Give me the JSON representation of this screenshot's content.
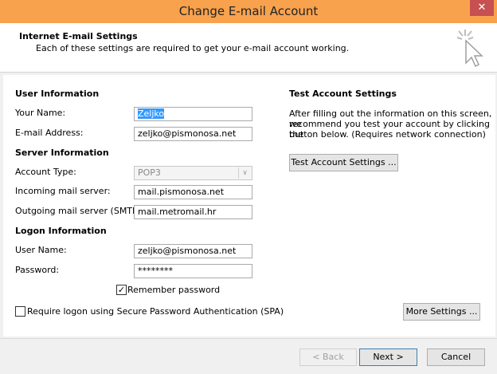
{
  "window": {
    "title": "Change E-mail Account",
    "close_glyph": "✕"
  },
  "header": {
    "title": "Internet E-mail Settings",
    "subtitle": "Each of these settings are required to get your e-mail account working.",
    "icon": "wizard-cursor-icon"
  },
  "user_information": {
    "heading": "User Information",
    "name_label": "Your Name:",
    "name_value": "Zeljko",
    "email_label": "E-mail Address:",
    "email_value": "zeljko@pismonosa.net"
  },
  "server_information": {
    "heading": "Server Information",
    "account_type_label": "Account Type:",
    "account_type_value": "POP3",
    "incoming_label": "Incoming mail server:",
    "incoming_value": "mail.pismonosa.net",
    "outgoing_label": "Outgoing mail server (SMTP):",
    "outgoing_value": "mail.metromail.hr"
  },
  "logon_information": {
    "heading": "Logon Information",
    "username_label": "User Name:",
    "username_value": "zeljko@pismonosa.net",
    "password_label": "Password:",
    "password_value": "********",
    "remember_label": "Remember password",
    "remember_checked": true,
    "spa_label": "Require logon using Secure Password Authentication (SPA)",
    "spa_checked": false
  },
  "test_settings": {
    "heading": "Test Account Settings",
    "description_line1": "After filling out the information on this screen, we",
    "description_line2": "recommend you test your account by clicking the",
    "description_line3": "button below. (Requires network connection)",
    "button_label": "Test Account Settings ..."
  },
  "more_settings_label": "More Settings ...",
  "footer": {
    "back_label": "< Back",
    "next_label": "Next >",
    "cancel_label": "Cancel"
  },
  "colors": {
    "titlebar": "#f8a24e",
    "close": "#c75050",
    "selection": "#3399ff"
  }
}
